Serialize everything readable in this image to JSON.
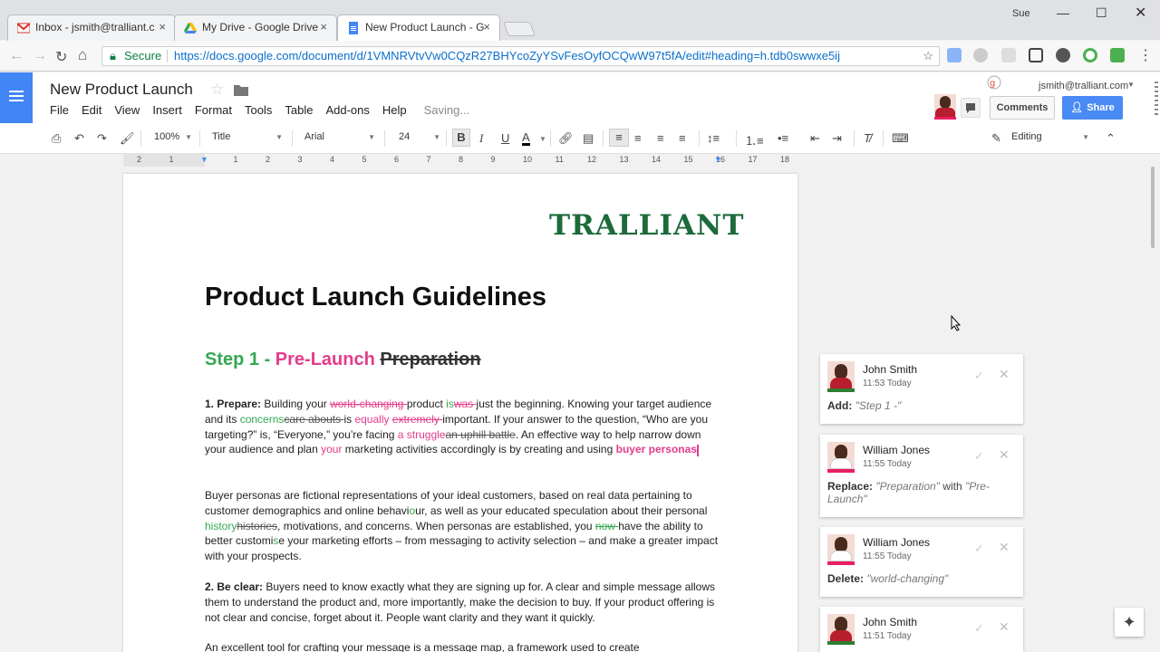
{
  "browser": {
    "tabs": [
      {
        "title": "Inbox - jsmith@tralliant.c",
        "icon": "gmail-icon"
      },
      {
        "title": "My Drive - Google Drive",
        "icon": "drive-icon"
      },
      {
        "title": "New Product Launch - G",
        "icon": "docs-icon"
      }
    ],
    "user": "Sue",
    "security_label": "Secure",
    "url": "https://docs.google.com/document/d/1VMNRVtvVw0CQzR27BHYcoZyYSvFesOyfOCQwW97t5fA/edit#heading=h.tdb0swwxe5ij"
  },
  "doc": {
    "title": "New Product Launch",
    "menu": [
      "File",
      "Edit",
      "View",
      "Insert",
      "Format",
      "Tools",
      "Table",
      "Add-ons",
      "Help"
    ],
    "status": "Saving...",
    "account": "jsmith@tralliant.com",
    "comments_label": "Comments",
    "share_label": "Share"
  },
  "format_toolbar": {
    "zoom": "100%",
    "style": "Title",
    "font": "Arial",
    "size": "24",
    "mode": "Editing"
  },
  "ruler": {
    "ticks": [
      "2",
      "1",
      "",
      "1",
      "2",
      "3",
      "4",
      "5",
      "6",
      "7",
      "8",
      "9",
      "10",
      "11",
      "12",
      "13",
      "14",
      "15",
      "16",
      "17",
      "18"
    ]
  },
  "page": {
    "logo": "TRALLIANT",
    "heading": "Product Launch Guidelines",
    "step": {
      "green": "Step 1 - ",
      "pink": "Pre-Launch",
      "deleted": "Preparation"
    },
    "p1": {
      "label": "1. Prepare:",
      "t1": " Building your ",
      "d1": "world-changing ",
      "t2": "product ",
      "i1": "is",
      "d2": "was ",
      "t3": "just the beginning. Knowing your target audience and its ",
      "i2": "concerns",
      "d3": "care abouts ",
      "t4": "is ",
      "i3": "equally ",
      "d4": "extremely ",
      "t5": "important. If your answer to the question, “Who are you targeting?” is, “Everyone,” you’re facing ",
      "i4": "a struggle",
      "d5": "an uphill battle",
      "t6": ". An effective way to help narrow down your audience and plan ",
      "i5": "your",
      "t7": " marketing activities accordingly is by creating and using ",
      "i6": "buyer personas"
    },
    "p2": {
      "t1": "Buyer personas are fictional representations of your ideal customers, based on real data pertaining to customer demographics and online behavi",
      "i1": "o",
      "t2": "ur, as well as your educated speculation about their personal ",
      "i2": "history",
      "d1": "histories",
      "t3": ", motivations, and concerns. When personas are established, you ",
      "d2": "now ",
      "t4": "have the ability to better customi",
      "i3": "s",
      "t5": "e your marketing efforts – from messaging to activity selection – and make a greater impact with your prospects."
    },
    "p3": {
      "label": "2. Be clear:",
      "text": " Buyers need to know exactly what they are signing up for. A clear and simple message allows them to understand the product and, more importantly, make the decision to buy. If your product offering is not clear and concise, forget about it. People want clarity and they want it quickly."
    },
    "p4": "An excellent tool for crafting your message is a message map, a framework used to create"
  },
  "comments": [
    {
      "name": "John Smith",
      "time": "11:53 Today",
      "action": "Add:",
      "text": "\"Step 1 -\"",
      "mid": "",
      "text2": ""
    },
    {
      "name": "William Jones",
      "time": "11:55 Today",
      "action": "Replace:",
      "text": "\"Preparation\"",
      "mid": " with ",
      "text2": "\"Pre-Launch\""
    },
    {
      "name": "William Jones",
      "time": "11:55 Today",
      "action": "Delete:",
      "text": "\"world-changing\"",
      "mid": "",
      "text2": ""
    },
    {
      "name": "John Smith",
      "time": "11:51 Today",
      "action": "",
      "text": "",
      "mid": "",
      "text2": ""
    }
  ]
}
